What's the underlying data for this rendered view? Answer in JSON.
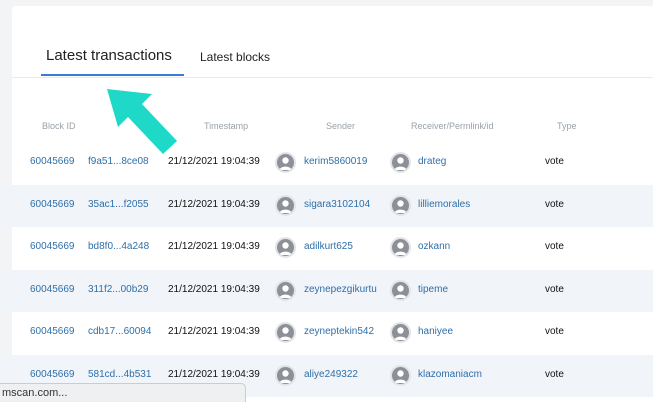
{
  "tabs": {
    "active_label": "Latest transactions",
    "inactive_label": "Latest blocks"
  },
  "columns": {
    "block_id": "Block ID",
    "timestamp": "Timestamp",
    "sender": "Sender",
    "receiver": "Receiver/Permlink/id",
    "type": "Type"
  },
  "rows": [
    {
      "block": "60045669",
      "tx": "f9a51...8ce08",
      "time": "21/12/2021 19:04:39",
      "sender": "kerim5860019",
      "receiver": "drateg",
      "type": "vote"
    },
    {
      "block": "60045669",
      "tx": "35ac1...f2055",
      "time": "21/12/2021 19:04:39",
      "sender": "sigara3102104",
      "receiver": "lilliemorales",
      "type": "vote"
    },
    {
      "block": "60045669",
      "tx": "bd8f0...4a248",
      "time": "21/12/2021 19:04:39",
      "sender": "adilkurt625",
      "receiver": "ozkann",
      "type": "vote"
    },
    {
      "block": "60045669",
      "tx": "311f2...00b29",
      "time": "21/12/2021 19:04:39",
      "sender": "zeynepezgikurtu",
      "receiver": "tipeme",
      "type": "vote"
    },
    {
      "block": "60045669",
      "tx": "cdb17...60094",
      "time": "21/12/2021 19:04:39",
      "sender": "zeyneptekin542",
      "receiver": "haniyee",
      "type": "vote"
    },
    {
      "block": "60045669",
      "tx": "581cd...4b531",
      "time": "21/12/2021 19:04:39",
      "sender": "aliye249322",
      "receiver": "klazomaniacm",
      "type": "vote"
    }
  ],
  "status_bar": {
    "text": "mscan.com..."
  },
  "colors": {
    "accent": "#3b7bd4",
    "link": "#2f6fa8",
    "annotation_arrow": "#1ed8c8"
  },
  "icons": {
    "avatar": "user-avatar-icon",
    "arrow": "pointer-arrow-icon"
  }
}
